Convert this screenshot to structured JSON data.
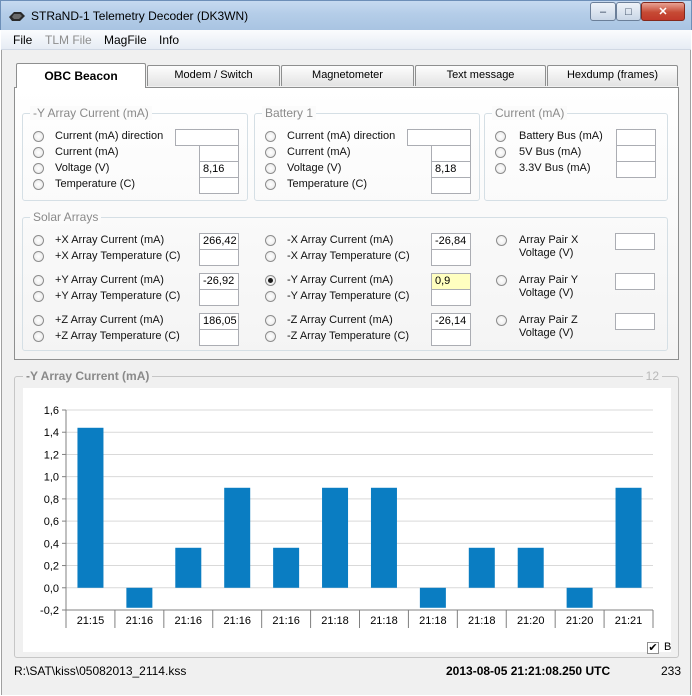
{
  "window": {
    "title": "STRaND-1 Telemetry Decoder (DK3WN)",
    "minimize": "–",
    "maximize": "□",
    "close": "✕"
  },
  "menu": [
    "File",
    "TLM File",
    "MagFile",
    "Info"
  ],
  "tabs": [
    "OBC Beacon",
    "Modem / Switch",
    "Magnetometer",
    "Text message",
    "Hexdump (frames)"
  ],
  "groups": {
    "y_array": {
      "title": "-Y Array Current (mA)",
      "rows": [
        {
          "label": "Current (mA) direction",
          "value": ""
        },
        {
          "label": "Current (mA)",
          "value": ""
        },
        {
          "label": "Voltage (V)",
          "value": "8,16"
        },
        {
          "label": "Temperature (C)",
          "value": ""
        }
      ]
    },
    "battery": {
      "title": "Battery 1",
      "rows": [
        {
          "label": "Current (mA) direction",
          "value": ""
        },
        {
          "label": "Current (mA)",
          "value": ""
        },
        {
          "label": "Voltage (V)",
          "value": "8,18"
        },
        {
          "label": "Temperature (C)",
          "value": ""
        }
      ]
    },
    "current": {
      "title": "Current (mA)",
      "rows": [
        {
          "label": "Battery Bus (mA)",
          "value": ""
        },
        {
          "label": "5V Bus (mA)",
          "value": ""
        },
        {
          "label": "3.3V Bus (mA)",
          "value": ""
        }
      ]
    },
    "solar": {
      "title": "Solar Arrays",
      "col1": [
        {
          "label": "+X Array Current (mA)",
          "value": "266,42"
        },
        {
          "label": "+X Array Temperature (C)",
          "value": ""
        },
        {
          "label": "+Y Array Current (mA)",
          "value": "-26,92"
        },
        {
          "label": "+Y Array Temperature (C)",
          "value": ""
        },
        {
          "label": "+Z Array Current (mA)",
          "value": "186,05"
        },
        {
          "label": "+Z Array Temperature (C)",
          "value": ""
        }
      ],
      "col2": [
        {
          "label": "-X Array Current (mA)",
          "value": "-26,84"
        },
        {
          "label": "-X Array Temperature (C)",
          "value": ""
        },
        {
          "label": "-Y Array Current (mA)",
          "value": "0,9"
        },
        {
          "label": "-Y Array Temperature (C)",
          "value": ""
        },
        {
          "label": "-Z Array Current (mA)",
          "value": "-26,14"
        },
        {
          "label": "-Z Array Temperature (C)",
          "value": ""
        }
      ],
      "col3": [
        {
          "line1": "Array Pair X",
          "line2": "Voltage (V)",
          "value": ""
        },
        {
          "line1": "Array Pair Y",
          "line2": "Voltage (V)",
          "value": ""
        },
        {
          "line1": "Array Pair Z",
          "line2": "Voltage (V)",
          "value": ""
        }
      ]
    }
  },
  "chart_panel": {
    "title": "-Y Array Current (mA)",
    "count": "12",
    "checkbox_label": "B",
    "checkbox_mark": "✔"
  },
  "chart_data": {
    "type": "bar",
    "categories": [
      "21:15",
      "21:16",
      "21:16",
      "21:16",
      "21:16",
      "21:18",
      "21:18",
      "21:18",
      "21:18",
      "21:20",
      "21:20",
      "21:21"
    ],
    "values": [
      1.44,
      -0.18,
      0.36,
      0.9,
      0.36,
      0.9,
      0.9,
      -0.18,
      0.36,
      0.36,
      -0.18,
      0.9
    ],
    "ylim": [
      -0.2,
      1.6
    ],
    "yticks": [
      "-0,2",
      "0,0",
      "0,2",
      "0,4",
      "0,6",
      "0,8",
      "1,0",
      "1,2",
      "1,4",
      "1,6"
    ],
    "bar_color": "#0a7dc2",
    "grid": "horizontal",
    "title": "",
    "xlabel": "",
    "ylabel": ""
  },
  "status": {
    "path": "R:\\SAT\\kiss\\05082013_2114.kss",
    "timestamp": "2013-08-05  21:21:08.250 UTC",
    "count": "233"
  }
}
